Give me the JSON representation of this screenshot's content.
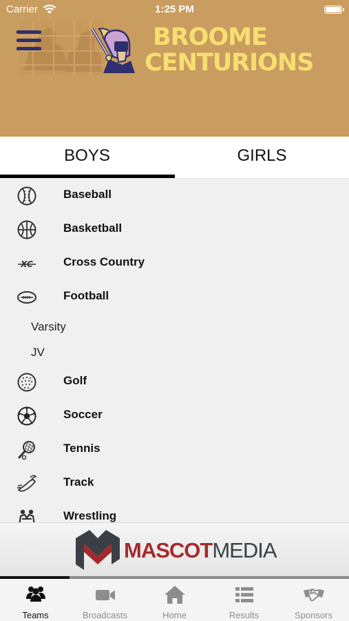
{
  "status_bar": {
    "carrier": "Carrier",
    "time": "1:25 PM"
  },
  "header": {
    "title_line1": "BROOME",
    "title_line2": "CENTURIONS"
  },
  "tabs": [
    {
      "label": "BOYS",
      "selected": true
    },
    {
      "label": "GIRLS",
      "selected": false
    }
  ],
  "sports": [
    {
      "label": "Baseball",
      "icon": "baseball-icon"
    },
    {
      "label": "Basketball",
      "icon": "basketball-icon"
    },
    {
      "label": "Cross Country",
      "icon": "cross-country-icon"
    },
    {
      "label": "Football",
      "icon": "football-icon",
      "subitems": [
        "Varsity",
        "JV"
      ]
    },
    {
      "label": "Golf",
      "icon": "golf-ball-icon"
    },
    {
      "label": "Soccer",
      "icon": "soccer-ball-icon"
    },
    {
      "label": "Tennis",
      "icon": "tennis-racket-icon"
    },
    {
      "label": "Track",
      "icon": "track-shoe-icon"
    },
    {
      "label": "Wrestling",
      "icon": "wrestling-icon"
    }
  ],
  "sponsor_banner": {
    "name_part1": "MASCOT",
    "name_part2": "MEDIA"
  },
  "banner_progress": 0.2,
  "tab_bar": [
    {
      "label": "Teams",
      "icon": "teams-icon",
      "active": true
    },
    {
      "label": "Broadcasts",
      "icon": "video-camera-icon",
      "active": false
    },
    {
      "label": "Home",
      "icon": "home-icon",
      "active": false
    },
    {
      "label": "Results",
      "icon": "list-icon",
      "active": false
    },
    {
      "label": "Sponsors",
      "icon": "handshake-icon",
      "active": false
    }
  ],
  "colors": {
    "header_bg": "#c99c5f",
    "title_yellow": "#f6df72",
    "navy": "#2e2f6e",
    "brand_red": "#a52a2e"
  }
}
